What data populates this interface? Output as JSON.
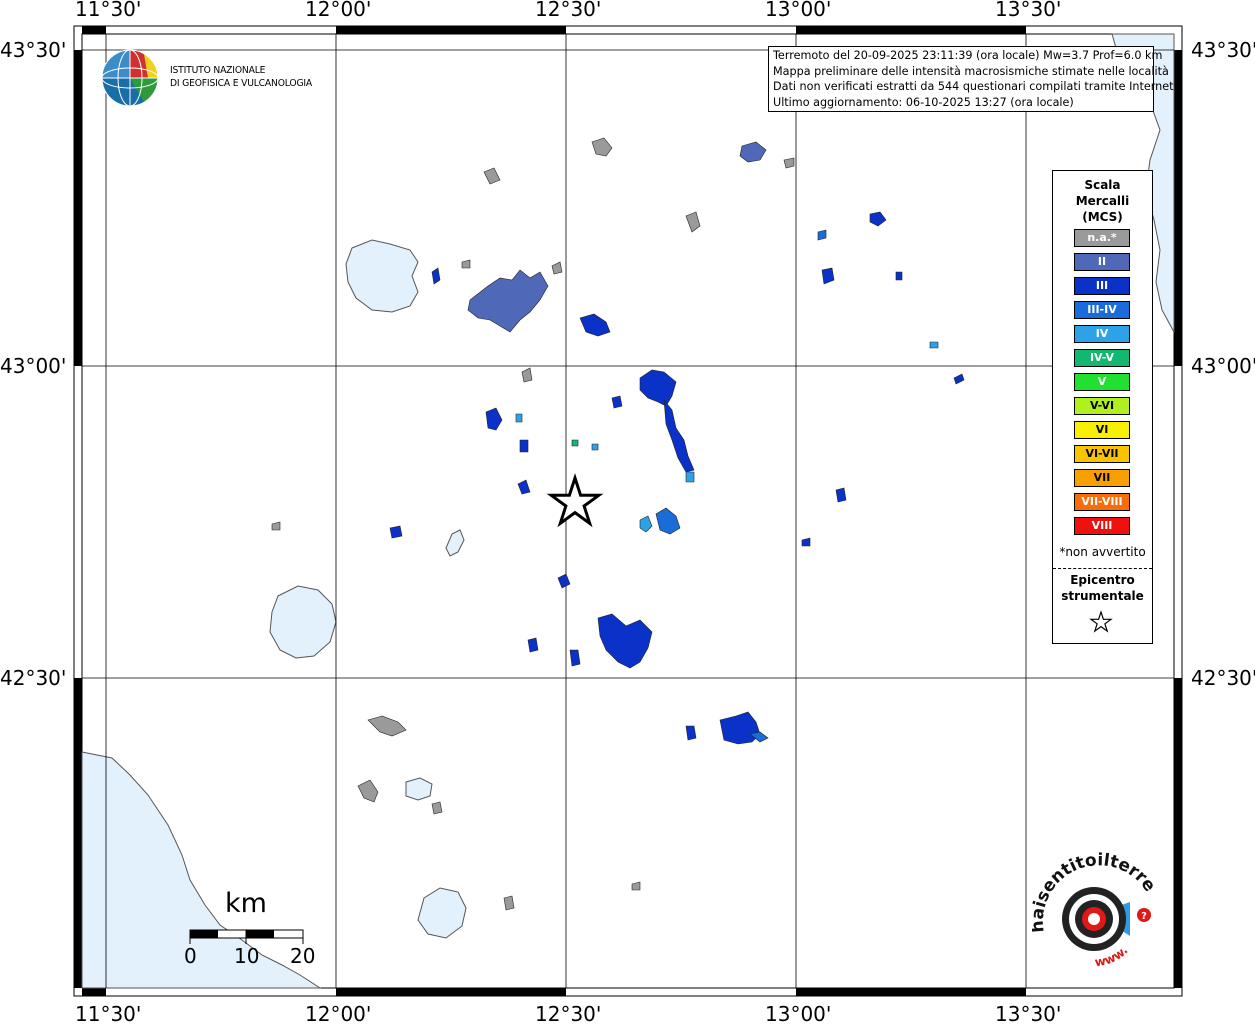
{
  "coords": {
    "top_lon": [
      "11°30'",
      "12°00'",
      "12°30'",
      "13°00'",
      "13°30'"
    ],
    "bottom_lon": [
      "11°30'",
      "12°00'",
      "12°30'",
      "13°00'",
      "13°30'"
    ],
    "left_lat": [
      "43°30'",
      "43°00'",
      "42°30'"
    ],
    "right_lat": [
      "43°30'",
      "43°00'",
      "42°30'"
    ]
  },
  "info": {
    "line1": "Terremoto del 20-09-2025 23:11:39 (ora locale) Mw=3.7 Prof=6.0 km",
    "line2": "Mappa preliminare delle intensità macrosismiche stimate nelle località",
    "line3": "Dati non verificati estratti da 544 questionari compilati tramite Internet.",
    "line4": "Ultimo aggiornamento: 06-10-2025 13:27 (ora locale)"
  },
  "logo": {
    "line1": "ISTITUTO NAZIONALE",
    "line2": "DI GEOFISICA E VULCANOLOGIA"
  },
  "legend": {
    "title1": "Scala",
    "title2": "Mercalli",
    "title3": "(MCS)",
    "items": [
      {
        "label": "n.a.*",
        "color": "#9a9a9a"
      },
      {
        "label": "II",
        "color": "#5068b8"
      },
      {
        "label": "III",
        "color": "#0a32c8"
      },
      {
        "label": "III-IV",
        "color": "#1a6cd8"
      },
      {
        "label": "IV",
        "color": "#2ea2e8"
      },
      {
        "label": "IV-V",
        "color": "#12b870"
      },
      {
        "label": "V",
        "color": "#20e030"
      },
      {
        "label": "V-VI",
        "color": "#b0f020"
      },
      {
        "label": "VI",
        "color": "#f8f000"
      },
      {
        "label": "VI-VII",
        "color": "#f8c400"
      },
      {
        "label": "VII",
        "color": "#f8a000"
      },
      {
        "label": "VII-VIII",
        "color": "#f86c0c"
      },
      {
        "label": "VIII",
        "color": "#f01010"
      }
    ],
    "note": "*non avvertito",
    "epi1": "Epicentro",
    "epi2": "strumentale"
  },
  "scale": {
    "unit": "km",
    "ticks": [
      "0",
      "10",
      "20"
    ]
  },
  "brand": {
    "text": "haisentitoilterremoto.it",
    "www": "www."
  },
  "colors": {
    "water": "#e3f1fc",
    "na": "#9a9a9a",
    "II": "#5068b8",
    "III": "#0a32c8",
    "IIIIV": "#1a6cd8",
    "IV": "#2ea2e8",
    "IVV": "#12b870"
  }
}
